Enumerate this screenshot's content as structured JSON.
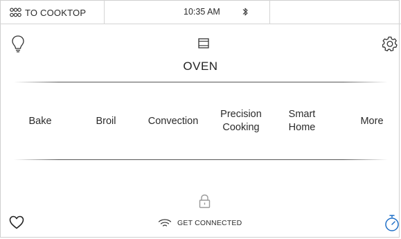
{
  "status_bar": {
    "cooktop_label": "TO COOKTOP",
    "time": "10:35 AM",
    "cooktop_icon": "burners-icon",
    "bluetooth_icon": "bluetooth-icon"
  },
  "header": {
    "title": "OVEN",
    "light_icon": "lightbulb-icon",
    "settings_icon": "gear-icon",
    "oven_icon": "oven-icon"
  },
  "modes": [
    {
      "label": "Bake"
    },
    {
      "label": "Broil"
    },
    {
      "label": "Convection"
    },
    {
      "label": "Precision\nCooking"
    },
    {
      "label": "Smart\nHome"
    },
    {
      "label": "More"
    }
  ],
  "footer": {
    "connect_label": "GET CONNECTED",
    "wifi_icon": "wifi-icon",
    "lock_icon": "lock-icon",
    "favorite_icon": "heart-icon",
    "timer_icon": "timer-icon"
  },
  "colors": {
    "accent_timer": "#1f6fc7",
    "text": "#222222",
    "lock_gray": "#9a9a9a"
  }
}
